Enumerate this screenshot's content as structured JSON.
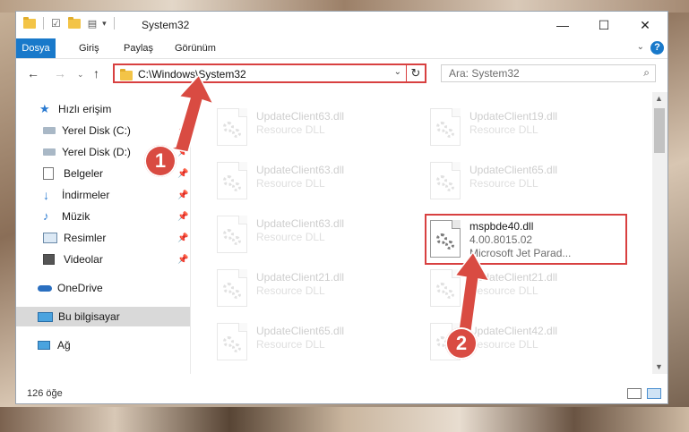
{
  "window": {
    "title": "System32",
    "controls": {
      "minimize": "—",
      "maximize": "☐",
      "close": "✕"
    }
  },
  "ribbon": {
    "tabs": [
      "Dosya",
      "Giriş",
      "Paylaş",
      "Görünüm"
    ],
    "help": "?"
  },
  "nav": {
    "address": "C:\\Windows\\System32",
    "search_placeholder": "Ara: System32"
  },
  "sidebar": {
    "items": [
      {
        "label": "Hızlı erişim",
        "icon": "star-icon"
      },
      {
        "label": "Yerel Disk (C:)",
        "icon": "drive-icon"
      },
      {
        "label": "Yerel Disk (D:)",
        "icon": "drive-icon"
      },
      {
        "label": "Belgeler",
        "icon": "documents-icon"
      },
      {
        "label": "İndirmeler",
        "icon": "download-icon"
      },
      {
        "label": "Müzik",
        "icon": "music-icon"
      },
      {
        "label": "Resimler",
        "icon": "pictures-icon"
      },
      {
        "label": "Videolar",
        "icon": "videos-icon"
      },
      {
        "label": "OneDrive",
        "icon": "cloud-icon"
      },
      {
        "label": "Bu bilgisayar",
        "icon": "computer-icon"
      },
      {
        "label": "Ağ",
        "icon": "network-icon"
      }
    ]
  },
  "files": [
    {
      "name": "UpdateClient63.dll",
      "type": "Resource DLL"
    },
    {
      "name": "UpdateClient19.dll",
      "type": "Resource DLL"
    },
    {
      "name": "UpdateClient63.dll",
      "type": "Resource DLL"
    },
    {
      "name": "UpdateClient65.dll",
      "type": "Resource DLL"
    },
    {
      "name": "UpdateClient63.dll",
      "type": "Resource DLL"
    },
    {
      "name": "mspbde40.dll",
      "version": "4.00.8015.02",
      "description": "Microsoft Jet Parad..."
    },
    {
      "name": "UpdateClient21.dll",
      "type": "Resource DLL"
    },
    {
      "name": "UpdateClient21.dll",
      "type": "Resource DLL"
    },
    {
      "name": "UpdateClient65.dll",
      "type": "Resource DLL"
    },
    {
      "name": "UpdateClient42.dll",
      "type": "Resource DLL"
    }
  ],
  "status": {
    "item_count": "126 öğe"
  },
  "callouts": {
    "one": "1",
    "two": "2"
  },
  "colors": {
    "accent": "#1979ca",
    "highlight": "#d84040",
    "callout": "#d94b42"
  }
}
